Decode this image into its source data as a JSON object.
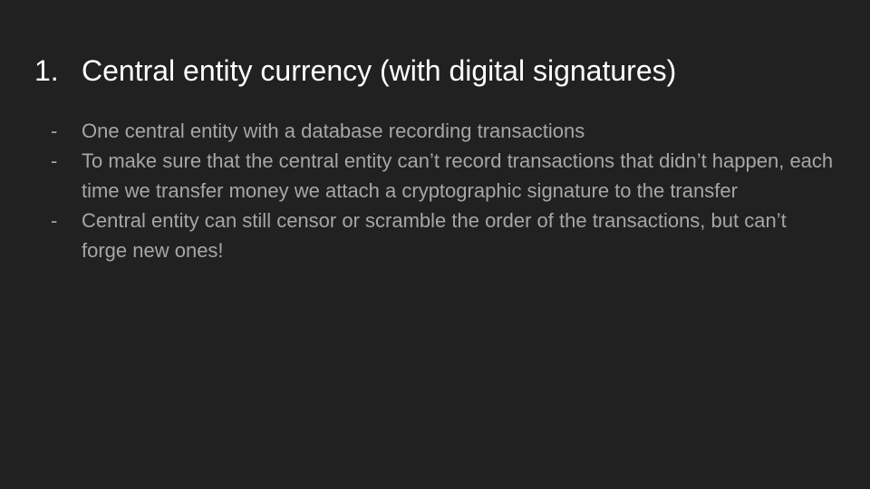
{
  "slide": {
    "title_number": "1.",
    "title": "Central entity currency (with digital signatures)",
    "bullet_marker": "-",
    "bullets": [
      {
        "text": "One central entity with a database recording transactions"
      },
      {
        "text": "To make sure that the central entity can’t record transactions that didn’t happen, each time we transfer money we attach a cryptographic signature to the transfer"
      },
      {
        "text": "Central entity can still censor or scramble the order of the transactions, but can’t forge new ones!"
      }
    ]
  },
  "colors": {
    "background": "#212121",
    "title": "#ffffff",
    "body_text": "#a6a6a6"
  }
}
